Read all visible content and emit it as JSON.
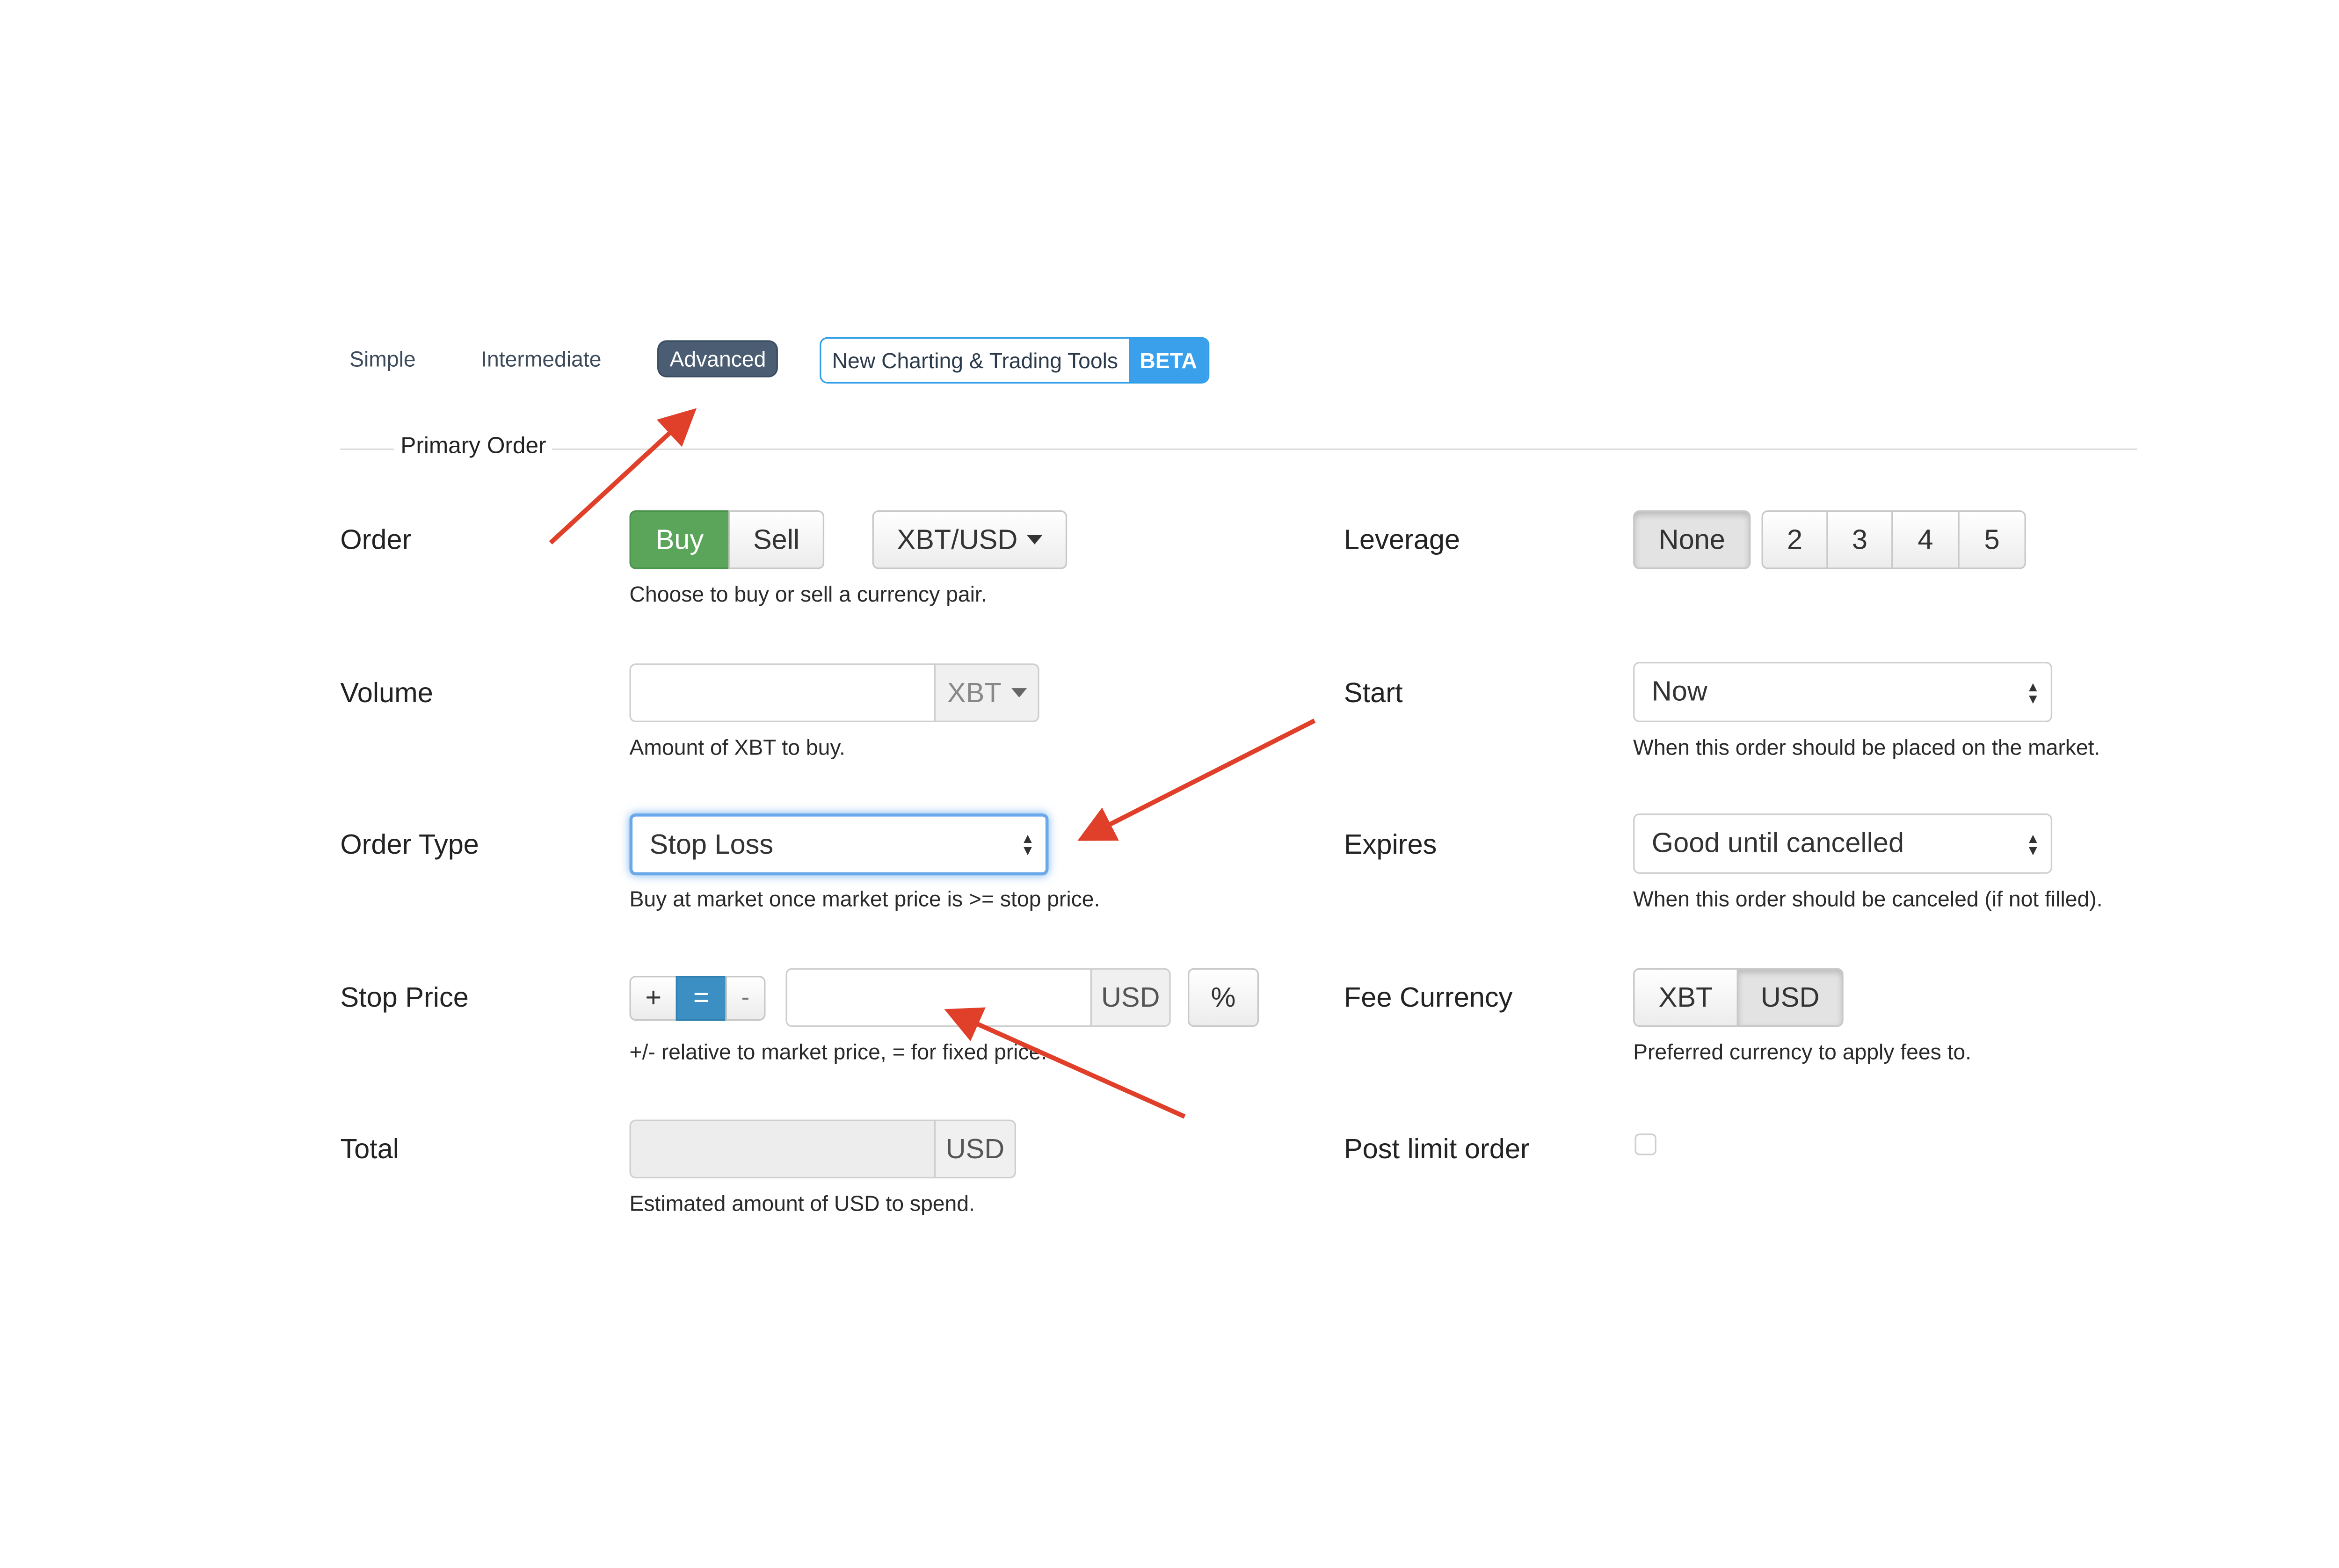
{
  "tabs": {
    "simple": "Simple",
    "intermediate": "Intermediate",
    "advanced": "Advanced",
    "tools": "New Charting & Trading Tools",
    "beta": "BETA"
  },
  "section": {
    "legend": "Primary Order"
  },
  "order": {
    "label": "Order",
    "buy": "Buy",
    "sell": "Sell",
    "pair": "XBT/USD",
    "help": "Choose to buy or sell a currency pair."
  },
  "volume": {
    "label": "Volume",
    "value": "",
    "unit": "XBT",
    "help": "Amount of XBT to buy."
  },
  "order_type": {
    "label": "Order Type",
    "selected": "Stop Loss",
    "help": "Buy at market once market price is >= stop price."
  },
  "stop_price": {
    "label": "Stop Price",
    "plus": "+",
    "equals": "=",
    "minus": "-",
    "value": "",
    "unit": "USD",
    "percent": "%",
    "help": "+/- relative to market price, = for fixed price."
  },
  "total": {
    "label": "Total",
    "value": "",
    "unit": "USD",
    "help": "Estimated amount of USD to spend."
  },
  "leverage": {
    "label": "Leverage",
    "none": "None",
    "options": [
      "2",
      "3",
      "4",
      "5"
    ]
  },
  "start": {
    "label": "Start",
    "selected": "Now",
    "help": "When this order should be placed on the market."
  },
  "expires": {
    "label": "Expires",
    "selected": "Good until cancelled",
    "help": "When this order should be canceled (if not filled)."
  },
  "fee_currency": {
    "label": "Fee Currency",
    "xbt": "XBT",
    "usd": "USD",
    "help": "Preferred currency to apply fees to."
  },
  "post_limit": {
    "label": "Post limit order",
    "checked": false
  },
  "colors": {
    "buy_green": "#5aa55a",
    "active_tab": "#4a5d72",
    "beta_blue": "#3aa0ec",
    "annotation_arrow": "#e0402a"
  }
}
